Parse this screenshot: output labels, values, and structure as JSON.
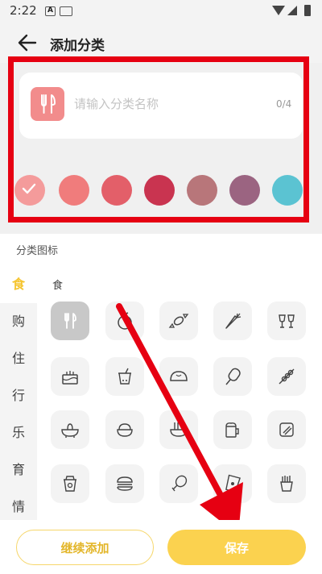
{
  "status_bar": {
    "time": "2:22"
  },
  "header": {
    "title": "添加分类",
    "back_icon": "arrow-left-icon"
  },
  "name_card": {
    "icon": "fork-knife-icon",
    "icon_bg": "#f28c8c",
    "placeholder": "请输入分类名称",
    "value": "",
    "counter": "0/4"
  },
  "colors": [
    {
      "hex": "#f49b9b",
      "selected": true
    },
    {
      "hex": "#f07c7c",
      "selected": false
    },
    {
      "hex": "#e35f69",
      "selected": false
    },
    {
      "hex": "#c93450",
      "selected": false
    },
    {
      "hex": "#b8767a",
      "selected": false
    },
    {
      "hex": "#9b6481",
      "selected": false
    },
    {
      "hex": "#5bc3d2",
      "selected": false
    }
  ],
  "icon_section": {
    "label": "分类图标",
    "tabs": [
      "食",
      "购",
      "住",
      "行",
      "乐",
      "育",
      "情"
    ],
    "active_tab": "食",
    "group_title": "食",
    "icons": [
      "fork-knife-icon",
      "apple-icon",
      "candy-icon",
      "carrot-icon",
      "cheers-icon",
      "cake-icon",
      "bubble-tea-icon",
      "bun-icon",
      "popsicle-icon",
      "skewer-icon",
      "hotpot-icon",
      "rice-bowl-icon",
      "noodle-bowl-icon",
      "beer-icon",
      "chopsticks-icon",
      "coffee-cup-icon",
      "burger-icon",
      "drumstick-icon",
      "snack-bag-icon",
      "fries-icon"
    ],
    "selected_icon": "fork-knife-icon"
  },
  "annotations": {
    "highlight_color": "#e60012"
  },
  "buttons": {
    "continue_label": "继续添加",
    "save_label": "保存"
  }
}
